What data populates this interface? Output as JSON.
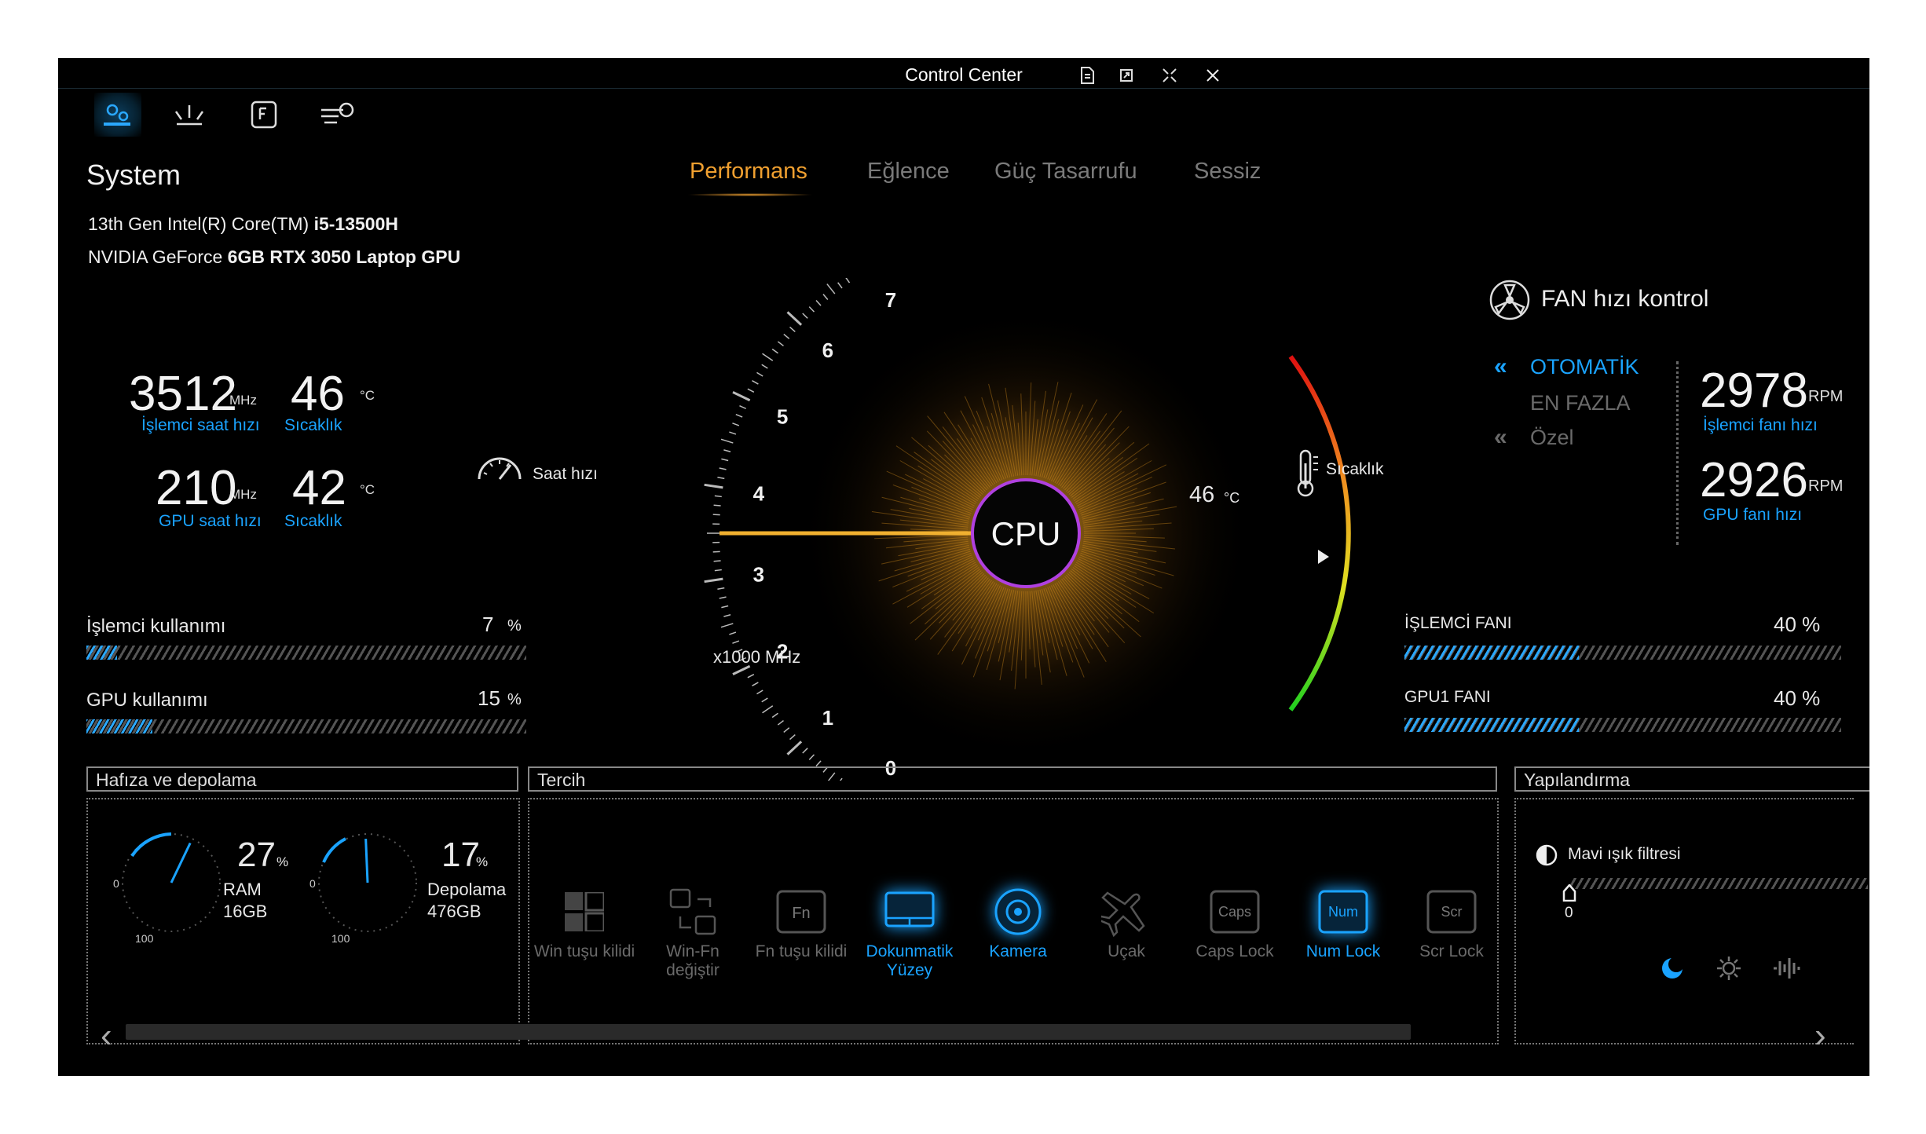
{
  "window": {
    "title": "Control Center",
    "controls": [
      "document-icon",
      "restore-icon",
      "compact-icon",
      "close-icon"
    ]
  },
  "nav": [
    "system-icon",
    "lighting-icon",
    "fn-key-icon",
    "fan-icon"
  ],
  "system": {
    "heading": "System",
    "cpu_prefix": "13th Gen Intel(R) Core(TM) ",
    "cpu_model": "i5-13500H",
    "gpu_prefix": "NVIDIA GeForce ",
    "gpu_model": "6GB RTX 3050 Laptop GPU",
    "cpu_clock": "3512",
    "cpu_clock_unit": "MHz",
    "cpu_clock_label": "İşlemci saat hızı",
    "cpu_temp": "46",
    "cpu_temp_unit": "°C",
    "cpu_temp_label": "Sıcaklık",
    "gpu_clock": "210",
    "gpu_clock_unit": "MHz",
    "gpu_clock_label": "GPU saat hızı",
    "gpu_temp": "42",
    "gpu_temp_unit": "°C",
    "gpu_temp_label": "Sıcaklık"
  },
  "usage": {
    "cpu_label": "İşlemci kullanımı",
    "cpu_value": "7",
    "cpu_unit": "%",
    "cpu_fraction": 0.07,
    "gpu_label": "GPU kullanımı",
    "gpu_value": "15",
    "gpu_unit": "%",
    "gpu_fraction": 0.15
  },
  "modes": {
    "items": [
      "Performans",
      "Eğlence",
      "Güç Tasarrufu",
      "Sessiz"
    ],
    "active": "Performans"
  },
  "gauge": {
    "clock_label": "Saat hızı",
    "center_label": "CPU",
    "ticks": [
      "7",
      "6",
      "5",
      "4",
      "3",
      "2",
      "1",
      "0"
    ],
    "scale_label": "x1000 MHz",
    "temp_label": "Sıcaklık",
    "temp_value": "46",
    "temp_unit": "°C",
    "clock_value_khz": 3.5
  },
  "fan": {
    "heading": "FAN hızı kontrol",
    "modes": [
      "OTOMATİK",
      "EN FAZLA",
      "Özel"
    ],
    "active_mode": "OTOMATİK",
    "cpu_rpm": "2978",
    "cpu_rpm_unit": "RPM",
    "cpu_rpm_label": "İşlemci fanı hızı",
    "gpu_rpm": "2926",
    "gpu_rpm_unit": "RPM",
    "gpu_rpm_label": "GPU fanı hızı",
    "cpu_fan_label": "İŞLEMCİ FANI",
    "cpu_fan_value": "40 %",
    "cpu_fan_fraction": 0.4,
    "gpu_fan_label": "GPU1 FANI",
    "gpu_fan_value": "40 %",
    "gpu_fan_fraction": 0.4
  },
  "memory": {
    "heading": "Hafıza ve depolama",
    "ram_percent": "27",
    "ram_unit": "%",
    "ram_label": "RAM",
    "ram_size": "16GB",
    "ram_fraction": 0.27,
    "disk_percent": "17",
    "disk_unit": "%",
    "disk_label": "Depolama",
    "disk_size": "476GB",
    "disk_fraction": 0.17,
    "dial_min": "0",
    "dial_max": "100"
  },
  "preferences": {
    "heading": "Tercih",
    "items": [
      {
        "label": "Win tuşu kilidi",
        "icon": "windows-icon",
        "on": false
      },
      {
        "label": "Win-Fn değiştir",
        "icon": "swap-keys-icon",
        "on": false
      },
      {
        "label": "Fn tuşu kilidi",
        "icon": "fn-icon",
        "fn_text": "Fn",
        "on": false
      },
      {
        "label": "Dokunmatik Yüzey",
        "icon": "touchpad-icon",
        "on": true
      },
      {
        "label": "Kamera",
        "icon": "camera-icon",
        "on": true
      },
      {
        "label": "Uçak",
        "icon": "airplane-icon",
        "on": false
      },
      {
        "label": "Caps Lock",
        "icon": "caps-icon",
        "key_text": "Caps",
        "on": false
      },
      {
        "label": "Num Lock",
        "icon": "num-icon",
        "key_text": "Num",
        "on": true
      },
      {
        "label": "Scr Lock",
        "icon": "scr-icon",
        "key_text": "Scr",
        "on": false
      }
    ]
  },
  "config": {
    "heading": "Yapılandırma",
    "blue_light_label": "Mavi ışık filtresi",
    "slider_value": "0",
    "slider_fraction": 0,
    "bottom_icons": [
      "night-mode-icon",
      "brightness-icon",
      "audio-icon"
    ]
  },
  "colors": {
    "accent": "#1aa3ff",
    "mode_active": "#f0a030",
    "background": "#000000"
  }
}
